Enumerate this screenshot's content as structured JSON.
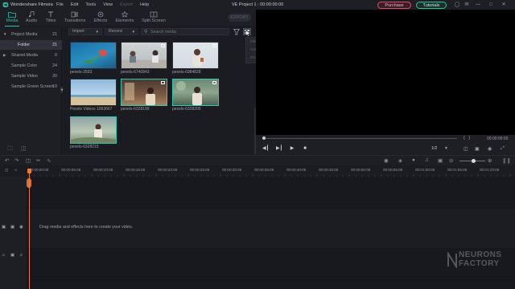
{
  "titlebar": {
    "app_name": "Wondershare Filmora",
    "menu": [
      "File",
      "Edit",
      "Tools",
      "View",
      "Export",
      "Help"
    ],
    "project": "VE Project 1 : 00:00:00:00",
    "purchase_label": "Purchase",
    "tutorials_label": "Tutorials"
  },
  "toolbar": {
    "tabs": [
      {
        "label": "Media",
        "icon": "folder-icon"
      },
      {
        "label": "Audio",
        "icon": "music-note-icon"
      },
      {
        "label": "Titles",
        "icon": "text-icon"
      },
      {
        "label": "Transitions",
        "icon": "transition-icon"
      },
      {
        "label": "Effects",
        "icon": "effects-icon"
      },
      {
        "label": "Elements",
        "icon": "elements-icon"
      },
      {
        "label": "Split Screen",
        "icon": "split-screen-icon"
      }
    ],
    "export_label": "EXPORT"
  },
  "sidebar": {
    "items": [
      {
        "label": "Project Media",
        "count": "21"
      },
      {
        "label": "Folder",
        "count": "21"
      },
      {
        "label": "Shared Media",
        "count": "0"
      },
      {
        "label": "Sample Color",
        "count": "24"
      },
      {
        "label": "Sample Video",
        "count": "20"
      },
      {
        "label": "Sample Green Screen",
        "count": "10"
      }
    ]
  },
  "media": {
    "import_label": "Import",
    "record_label": "Record",
    "search_placeholder": "Search media",
    "items": [
      {
        "name": "pexels-3593"
      },
      {
        "name": "pexels-6740843"
      },
      {
        "name": "pexels-6984828"
      },
      {
        "name": "Pexels Videos 1093667"
      },
      {
        "name": "pexels-6328199"
      },
      {
        "name": "pexels-6328209"
      },
      {
        "name": "pexels-6328215"
      }
    ]
  },
  "context_menu": {
    "items": [
      "Filter",
      "Sort by",
      "Group by"
    ]
  },
  "preview": {
    "timecode": "00:00:00:00",
    "page": "1/2"
  },
  "timeline": {
    "ruler_labels": [
      "00:00:00:00",
      "00:00:05:00",
      "00:00:10:00",
      "00:00:15:00",
      "00:00:20:00",
      "00:00:25:00",
      "00:00:30:00",
      "00:00:35:00",
      "00:00:40:00",
      "00:00:45:00",
      "00:00:50:00",
      "00:00:55:00",
      "00:01:00:00",
      "00:01:05:00",
      "00:01:10:00"
    ],
    "drop_hint": "Drag media and effects here to create your video."
  },
  "watermark": {
    "line1": "NEURONS",
    "line2": "FACTORY"
  }
}
